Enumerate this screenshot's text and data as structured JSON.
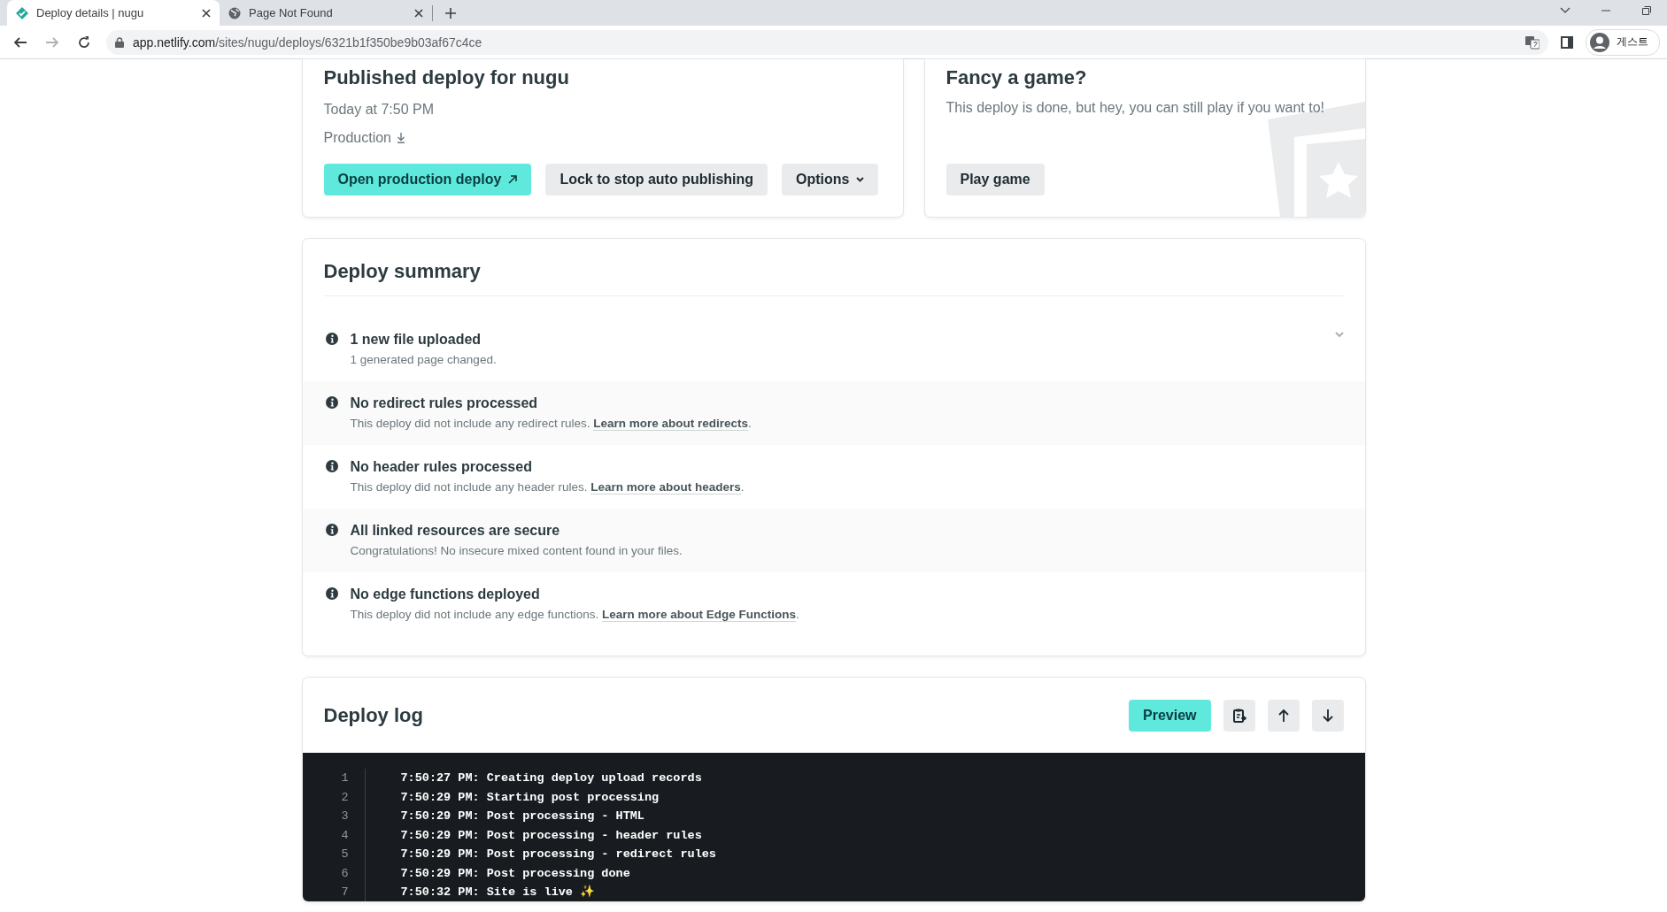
{
  "browser": {
    "tabs": [
      {
        "title": "Deploy details | nugu",
        "selected": true,
        "kind": "netlify"
      },
      {
        "title": "Page Not Found",
        "selected": false,
        "kind": "globe"
      }
    ],
    "address": {
      "host": "app.netlify.com",
      "path": "/sites/nugu/deploys/6321b1f350be9b03af67c4ce"
    },
    "profile": "게스트"
  },
  "published": {
    "title": "Published deploy for nugu",
    "time": "Today at 7:50 PM",
    "branch": "Production",
    "buttons": [
      {
        "label": "Open production deploy",
        "kind": "primary"
      },
      {
        "label": "Lock to stop auto publishing",
        "kind": "secondary"
      },
      {
        "label": "Options",
        "kind": "dropdown"
      }
    ]
  },
  "game": {
    "title": "Fancy a game?",
    "text": "This deploy is done, but hey, you can still play if you want to!",
    "button": "Play game"
  },
  "summary": {
    "title": "Deploy summary",
    "items": [
      {
        "title": "1 new file uploaded",
        "text": "1 generated page changed.",
        "expanded": false
      },
      {
        "title": "No redirect rules processed",
        "text": "This deploy did not include any redirect rules.",
        "link": "Learn more about redirects",
        "after": "."
      },
      {
        "title": "No header rules processed",
        "text": "This deploy did not include any header rules.",
        "link": "Learn more about headers",
        "after": "."
      },
      {
        "title": "All linked resources are secure",
        "text": "Congratulations! No insecure mixed content found in your files."
      },
      {
        "title": "No edge functions deployed",
        "text": "This deploy did not include any edge functions.",
        "link": "Learn more about Edge Functions",
        "after": "."
      }
    ]
  },
  "log": {
    "title": "Deploy log",
    "preview": "Preview",
    "lines": [
      {
        "number": "1",
        "text": "7:50:27 PM: Creating deploy upload records"
      },
      {
        "number": "2",
        "text": "7:50:29 PM: Starting post processing"
      },
      {
        "number": "3",
        "text": "7:50:29 PM: Post processing - HTML"
      },
      {
        "number": "4",
        "text": "7:50:29 PM: Post processing - header rules"
      },
      {
        "number": "5",
        "text": "7:50:29 PM: Post processing - redirect rules"
      },
      {
        "number": "6",
        "text": "7:50:29 PM: Post processing done"
      },
      {
        "number": "7",
        "text": "7:50:32 PM: Site is live ✨"
      }
    ]
  }
}
